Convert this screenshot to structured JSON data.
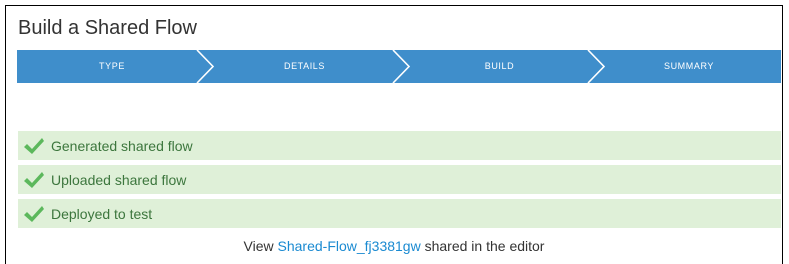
{
  "page": {
    "title": "Build a Shared Flow"
  },
  "wizard": {
    "color": "#3f8ecb",
    "steps": [
      {
        "label": "TYPE"
      },
      {
        "label": "DETAILS"
      },
      {
        "label": "BUILD"
      },
      {
        "label": "SUMMARY"
      }
    ]
  },
  "status": {
    "color": "#dff0d8",
    "check_color": "#5cb85c",
    "items": [
      {
        "label": "Generated shared flow",
        "icon": "check-icon"
      },
      {
        "label": "Uploaded shared flow",
        "icon": "check-icon"
      },
      {
        "label": "Deployed to test",
        "icon": "check-icon"
      }
    ]
  },
  "footer": {
    "prefix": "View",
    "link_text": "Shared-Flow_fj3381gw",
    "suffix": "shared in the editor"
  }
}
